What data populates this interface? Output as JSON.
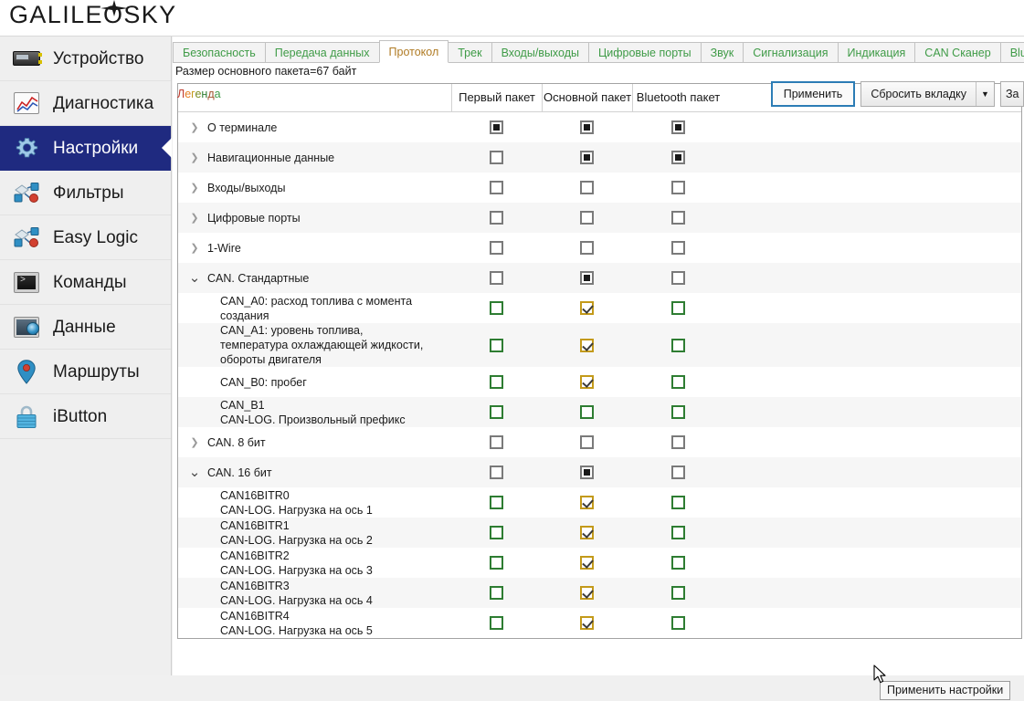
{
  "app": {
    "logo": "GALILEOSKY"
  },
  "sidebar": {
    "items": [
      {
        "label": "Устройство",
        "icon": "device-icon",
        "active": false
      },
      {
        "label": "Диагностика",
        "icon": "chart-icon",
        "active": false
      },
      {
        "label": "Настройки",
        "icon": "gear-icon",
        "active": true
      },
      {
        "label": "Фильтры",
        "icon": "filter-icon",
        "active": false
      },
      {
        "label": "Easy Logic",
        "icon": "easylogic-icon",
        "active": false
      },
      {
        "label": "Команды",
        "icon": "terminal-icon",
        "active": false
      },
      {
        "label": "Данные",
        "icon": "disk-icon",
        "active": false
      },
      {
        "label": "Маршруты",
        "icon": "map-pin-icon",
        "active": false
      },
      {
        "label": "iButton",
        "icon": "lock-icon",
        "active": false
      }
    ]
  },
  "tabs": {
    "items": [
      {
        "label": "Безопасность",
        "active": false
      },
      {
        "label": "Передача данных",
        "active": false
      },
      {
        "label": "Протокол",
        "active": true
      },
      {
        "label": "Трек",
        "active": false
      },
      {
        "label": "Входы/выходы",
        "active": false
      },
      {
        "label": "Цифровые порты",
        "active": false
      },
      {
        "label": "Звук",
        "active": false
      },
      {
        "label": "Сигнализация",
        "active": false
      },
      {
        "label": "Индикация",
        "active": false
      },
      {
        "label": "CAN Сканер",
        "active": false
      },
      {
        "label": "Bluetooth",
        "active": false
      }
    ],
    "active_color": "#b07b24",
    "inactive_color": "#3f9b47"
  },
  "main": {
    "packet_size_label": "Размер основного пакета=67 байт",
    "columns": [
      "",
      "Первый пакет",
      "Основной пакет",
      "Bluetooth пакет"
    ],
    "rows": [
      {
        "label": "О терминале",
        "type": "group",
        "expanded": false,
        "states": [
          "mid",
          "mid",
          "mid"
        ]
      },
      {
        "label": "Навигационные данные",
        "type": "group",
        "expanded": false,
        "states": [
          "off",
          "mid",
          "mid"
        ]
      },
      {
        "label": "Входы/выходы",
        "type": "group",
        "expanded": false,
        "states": [
          "off",
          "off",
          "off"
        ]
      },
      {
        "label": "Цифровые порты",
        "type": "group",
        "expanded": false,
        "states": [
          "off",
          "off",
          "off"
        ]
      },
      {
        "label": "1-Wire",
        "type": "group",
        "expanded": false,
        "states": [
          "off",
          "off",
          "off"
        ]
      },
      {
        "label": "CAN. Стандартные",
        "type": "group",
        "expanded": true,
        "states": [
          "off",
          "mid",
          "off"
        ]
      },
      {
        "label": "CAN_A0: расход топлива с момента создания",
        "type": "child",
        "states": [
          "green",
          "gold",
          "green"
        ]
      },
      {
        "label": "CAN_A1: уровень топлива,\nтемпература охлаждающей жидкости,\nобороты двигателя",
        "type": "child",
        "states": [
          "green",
          "gold",
          "green"
        ]
      },
      {
        "label": "CAN_B0: пробег",
        "type": "child",
        "states": [
          "green",
          "gold",
          "green"
        ]
      },
      {
        "label": "CAN_B1\nCAN-LOG. Произвольный префикс",
        "type": "child",
        "states": [
          "green",
          "green",
          "green"
        ]
      },
      {
        "label": "CAN. 8 бит",
        "type": "group",
        "expanded": false,
        "states": [
          "off",
          "off",
          "off"
        ]
      },
      {
        "label": "CAN. 16 бит",
        "type": "group",
        "expanded": true,
        "states": [
          "off",
          "mid",
          "off"
        ]
      },
      {
        "label": "CAN16BITR0\nCAN-LOG. Нагрузка на ось 1",
        "type": "child",
        "states": [
          "green",
          "gold",
          "green"
        ]
      },
      {
        "label": "CAN16BITR1\nCAN-LOG. Нагрузка на ось 2",
        "type": "child",
        "states": [
          "green",
          "gold",
          "green"
        ]
      },
      {
        "label": "CAN16BITR2\nCAN-LOG. Нагрузка на ось 3",
        "type": "child",
        "states": [
          "green",
          "gold",
          "green"
        ]
      },
      {
        "label": "CAN16BITR3\nCAN-LOG. Нагрузка на ось 4",
        "type": "child",
        "states": [
          "green",
          "gold",
          "green"
        ]
      },
      {
        "label": "CAN16BITR4\nCAN-LOG. Нагрузка на ось 5",
        "type": "child",
        "states": [
          "green",
          "gold",
          "green"
        ]
      },
      {
        "label": "",
        "type": "partial",
        "states": [
          "green",
          "gold",
          "green"
        ]
      }
    ]
  },
  "footer": {
    "legend_label": "Легенда",
    "legend_letters": [
      {
        "ch": "Л",
        "color": "#c0392b"
      },
      {
        "ch": "е",
        "color": "#e67e22"
      },
      {
        "ch": "г",
        "color": "#c39a1a"
      },
      {
        "ch": "е",
        "color": "#7a8a1e"
      },
      {
        "ch": "н",
        "color": "#2e7d32"
      },
      {
        "ch": "д",
        "color": "#a0522d"
      },
      {
        "ch": "а",
        "color": "#3f9b47"
      }
    ],
    "apply_button": "Применить",
    "reset_tab_button": "Сбросить вкладку",
    "reset_dropdown_arrow": "▼",
    "extra_button": "За",
    "tooltip": "Применить настройки"
  },
  "colors": {
    "accent_active_nav": "#1f2a80",
    "tab_text": "#3f9b47",
    "tab_active_text": "#b07b24",
    "checkbox_green": "#2e7d32",
    "checkbox_gold": "#c39a1a",
    "checkbox_gray": "#7a7a7a",
    "focus_border": "#2b7cb5"
  }
}
